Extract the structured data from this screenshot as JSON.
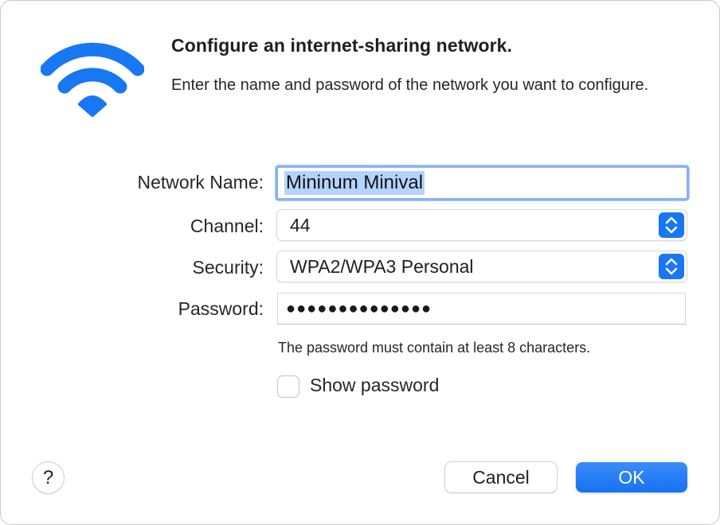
{
  "dialog": {
    "title": "Configure an internet-sharing network.",
    "subtitle": "Enter the name and password of the network you want to configure.",
    "icon": "wifi-icon"
  },
  "form": {
    "network_name": {
      "label": "Network Name:",
      "value": "Mininum Minival"
    },
    "channel": {
      "label": "Channel:",
      "value": "44"
    },
    "security": {
      "label": "Security:",
      "value": "WPA2/WPA3 Personal"
    },
    "password": {
      "label": "Password:",
      "masked_value": "●●●●●●●●●●●●●●"
    },
    "password_hint": "The password must contain at least 8 characters.",
    "show_password": {
      "label": "Show password",
      "checked": false
    }
  },
  "buttons": {
    "help": "?",
    "cancel": "Cancel",
    "ok": "OK"
  },
  "colors": {
    "accent": "#1877f2",
    "selection": "#b3d4fc",
    "focus_ring": "#86b3f3"
  }
}
